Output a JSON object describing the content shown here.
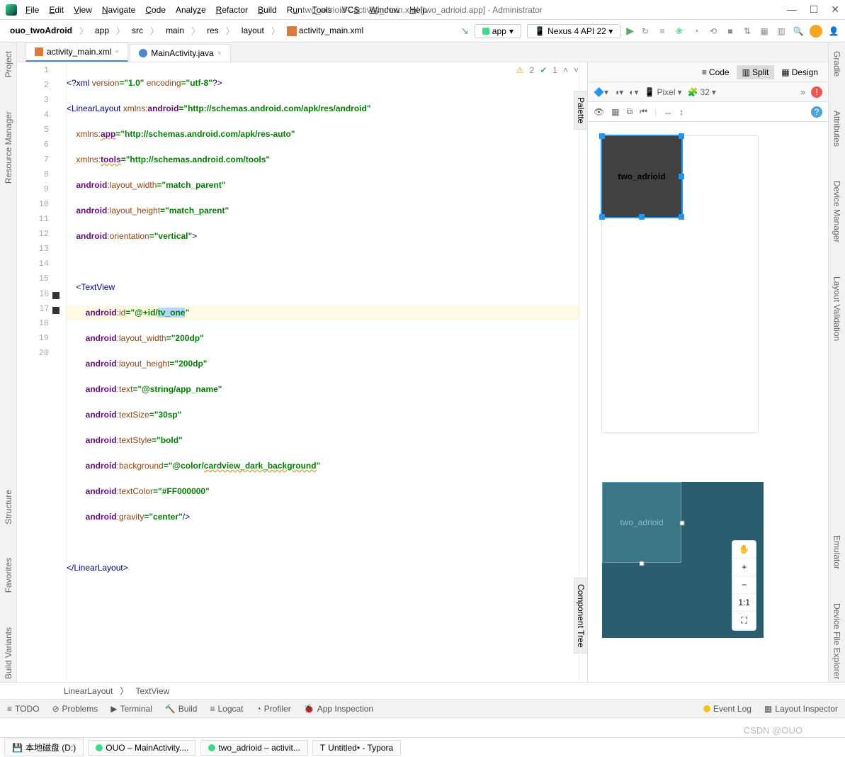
{
  "titlebar": {
    "menu": [
      "File",
      "Edit",
      "View",
      "Navigate",
      "Code",
      "Analyze",
      "Refactor",
      "Build",
      "Run",
      "Tools",
      "VCS",
      "Window",
      "Help"
    ],
    "title": "two_adrioid - activity_main.xml [two_adrioid.app] - Administrator"
  },
  "breadcrumb": {
    "items": [
      "ouo_twoAdroid",
      "app",
      "src",
      "main",
      "res",
      "layout",
      "activity_main.xml"
    ]
  },
  "navbar": {
    "app_label": "app",
    "device_label": "Nexus 4 API 22"
  },
  "tabs": {
    "t0": "activity_main.xml",
    "t1": "MainActivity.java"
  },
  "leftSidebar": {
    "project": "Project",
    "resourceManager": "Resource Manager",
    "structure": "Structure",
    "favorites": "Favorites",
    "buildVariants": "Build Variants"
  },
  "rightSidebar": {
    "gradle": "Gradle",
    "attributes": "Attributes",
    "deviceManager": "Device Manager",
    "layoutValidation": "Layout Validation",
    "emulator": "Emulator",
    "deviceFileExplorer": "Device File Explorer"
  },
  "designModes": {
    "code": "Code",
    "split": "Split",
    "design": "Design"
  },
  "designToolbar": {
    "device": "Pixel",
    "api": "32",
    "palette": "Palette",
    "componentTree": "Component Tree"
  },
  "editorBadges": {
    "warn_count": "2",
    "ok_count": "1"
  },
  "code": {
    "l1_a": "<?xml ",
    "l1_b": "version",
    "l1_c": "=\"1.0\" ",
    "l1_d": "encoding",
    "l1_e": "=\"utf-8\"",
    "l1_f": "?>",
    "l2_a": "<LinearLayout ",
    "l2_b": "xmlns:",
    "l2_c": "android",
    "l2_d": "=\"http://schemas.android.com/apk/res/android\"",
    "l3_a": "    xmlns:",
    "l3_b": "app",
    "l3_c": "=\"http://schemas.android.com/apk/res-auto\"",
    "l4_a": "    xmlns:",
    "l4_b": "tools",
    "l4_c": "=\"http://schemas.android.com/tools\"",
    "l5_a": "    android",
    "l5_b": ":layout_width",
    "l5_c": "=\"match_parent\"",
    "l6_a": "    android",
    "l6_b": ":layout_height",
    "l6_c": "=\"match_parent\"",
    "l7_a": "    android",
    "l7_b": ":orientation",
    "l7_c": "=\"vertical\"",
    "l7_d": ">",
    "l9_a": "    <TextView",
    "l10_a": "        android",
    "l10_b": ":id",
    "l10_c": "=\"@+id/",
    "l10_sel": "tv_one",
    "l10_d": "\"",
    "l11_a": "        android",
    "l11_b": ":layout_width",
    "l11_c": "=\"200dp\"",
    "l12_a": "        android",
    "l12_b": ":layout_height",
    "l12_c": "=\"200dp\"",
    "l13_a": "        android",
    "l13_b": ":text",
    "l13_c": "=\"@string/app_name\"",
    "l14_a": "        android",
    "l14_b": ":textSize",
    "l14_c": "=\"30sp\"",
    "l15_a": "        android",
    "l15_b": ":textStyle",
    "l15_c": "=\"bold\"",
    "l16_a": "        android",
    "l16_b": ":background",
    "l16_c": "=\"@color/",
    "l16_d": "cardview_dark_background",
    "l16_e": "\"",
    "l17_a": "        android",
    "l17_b": ":textColor",
    "l17_c": "=\"#FF000000\"",
    "l18_a": "        android",
    "l18_b": ":gravity",
    "l18_c": "=\"center\"",
    "l18_d": "/>",
    "l20_a": "</LinearLayout>"
  },
  "lineNumbers": [
    "1",
    "2",
    "3",
    "4",
    "5",
    "6",
    "7",
    "8",
    "9",
    "10",
    "11",
    "12",
    "13",
    "14",
    "15",
    "16",
    "17",
    "18",
    "19",
    "20"
  ],
  "preview": {
    "text": "two_adrioid",
    "bp_text": "two_adrioid"
  },
  "zoom": {
    "plus": "+",
    "minus": "−",
    "ratio": "1:1",
    "fit": "⛶",
    "hand": "✋"
  },
  "bottomBreadcrumb": {
    "a": "LinearLayout",
    "b": "TextView"
  },
  "bottomTools": {
    "todo": "TODO",
    "problems": "Problems",
    "terminal": "Terminal",
    "build": "Build",
    "logcat": "Logcat",
    "profiler": "Profiler",
    "appInspection": "App Inspection",
    "eventLog": "Event Log",
    "layoutInspector": "Layout Inspector"
  },
  "taskbar": {
    "disk": "本地磁盘 (D:)",
    "t1": "OUO – MainActivity....",
    "t2": "two_adrioid – activit...",
    "t3": "Untitled• - Typora"
  },
  "watermark": "CSDN @OUO"
}
